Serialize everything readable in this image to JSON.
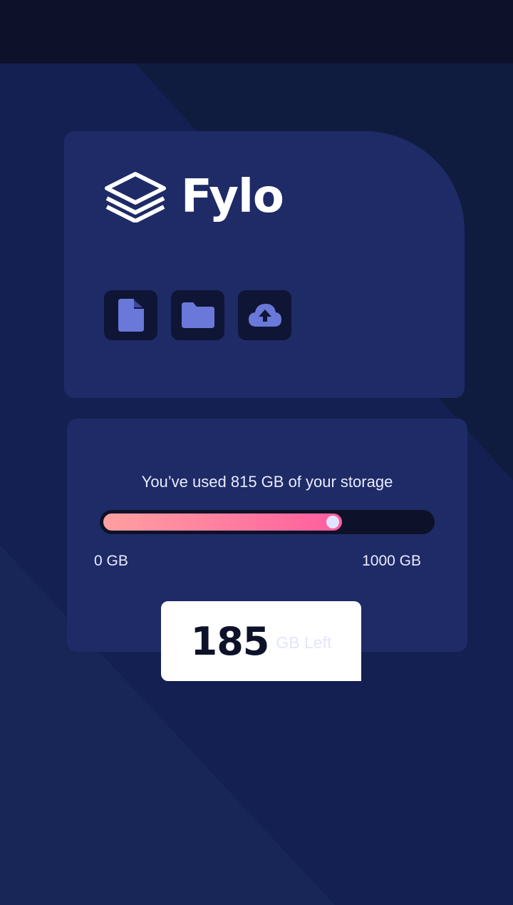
{
  "app": {
    "name": "Fylo"
  },
  "icons": [
    {
      "name": "document-icon"
    },
    {
      "name": "folder-icon"
    },
    {
      "name": "cloud-upload-icon"
    }
  ],
  "storage": {
    "usage_text": "You’ve used 815 GB of your storage",
    "used_gb": 815,
    "total_gb": 1000,
    "fill_fraction": 0.73,
    "min_label": "0 GB",
    "max_label": "1000 GB",
    "left_value": "185",
    "left_unit": "GB Left"
  },
  "colors": {
    "accent_icon": "#6a78d9",
    "card": "#1f2b66",
    "gradient_start": "#ffa0a0",
    "gradient_end": "#ff5d9e"
  }
}
